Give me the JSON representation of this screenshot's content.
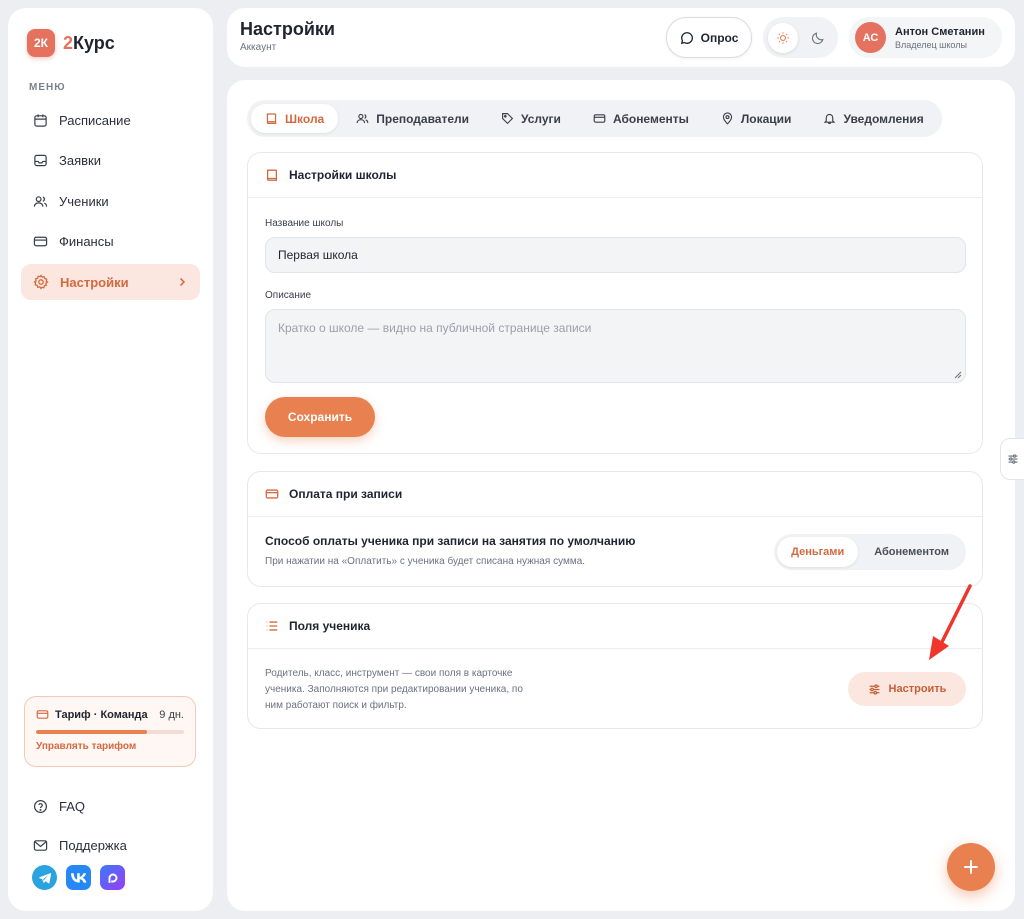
{
  "app": {
    "logo_badge": "2К",
    "logo_accent": "2",
    "logo_name": "Курс",
    "accent_color": "#e8804f",
    "brand_color": "#e4725f"
  },
  "sidebar": {
    "menu_caption": "МЕНЮ",
    "items": [
      {
        "label": "Расписание",
        "icon": "calendar-icon"
      },
      {
        "label": "Заявки",
        "icon": "inbox-icon"
      },
      {
        "label": "Ученики",
        "icon": "users-icon"
      },
      {
        "label": "Финансы",
        "icon": "card-icon"
      },
      {
        "label": "Настройки",
        "icon": "gear-icon",
        "active": true
      }
    ],
    "tariff": {
      "title": "Тариф · Команда",
      "days": "9 дн.",
      "progress_fraction": 0.75,
      "link": "Управлять тарифом"
    },
    "bottom_items": [
      {
        "label": "FAQ",
        "icon": "help-icon"
      },
      {
        "label": "Поддержка",
        "icon": "mail-icon"
      }
    ],
    "socials": [
      "telegram-icon",
      "vk-icon",
      "max-icon"
    ]
  },
  "header": {
    "title": "Настройки",
    "subtitle": "Аккаунт",
    "survey_label": "Опрос",
    "user": {
      "initials": "АС",
      "name": "Антон Сметанин",
      "role": "Владелец школы"
    }
  },
  "tabs": [
    {
      "label": "Школа",
      "icon": "book-icon",
      "active": true
    },
    {
      "label": "Преподаватели",
      "icon": "users-icon"
    },
    {
      "label": "Услуги",
      "icon": "tag-icon"
    },
    {
      "label": "Абонементы",
      "icon": "card-icon"
    },
    {
      "label": "Локации",
      "icon": "pin-icon"
    },
    {
      "label": "Уведомления",
      "icon": "bell-icon"
    }
  ],
  "school_card": {
    "title": "Настройки школы",
    "name_label": "Название школы",
    "name_value": "Первая школа",
    "description_label": "Описание",
    "description_placeholder": "Кратко о школе — видно на публичной странице записи",
    "save_label": "Сохранить"
  },
  "payment_card": {
    "title": "Оплата при записи",
    "setting_title": "Способ оплаты ученика при записи на занятия по умолчанию",
    "setting_hint": "При нажатии на «Оплатить» с ученика будет списана нужная сумма.",
    "options": [
      {
        "label": "Деньгами",
        "active": true
      },
      {
        "label": "Абонементом",
        "active": false
      }
    ]
  },
  "fields_card": {
    "title": "Поля ученика",
    "description": "Родитель, класс, инструмент — свои поля в карточке ученика. Заполняются при редактировании ученика, по ним работают поиск и фильтр.",
    "configure_label": "Настроить"
  }
}
